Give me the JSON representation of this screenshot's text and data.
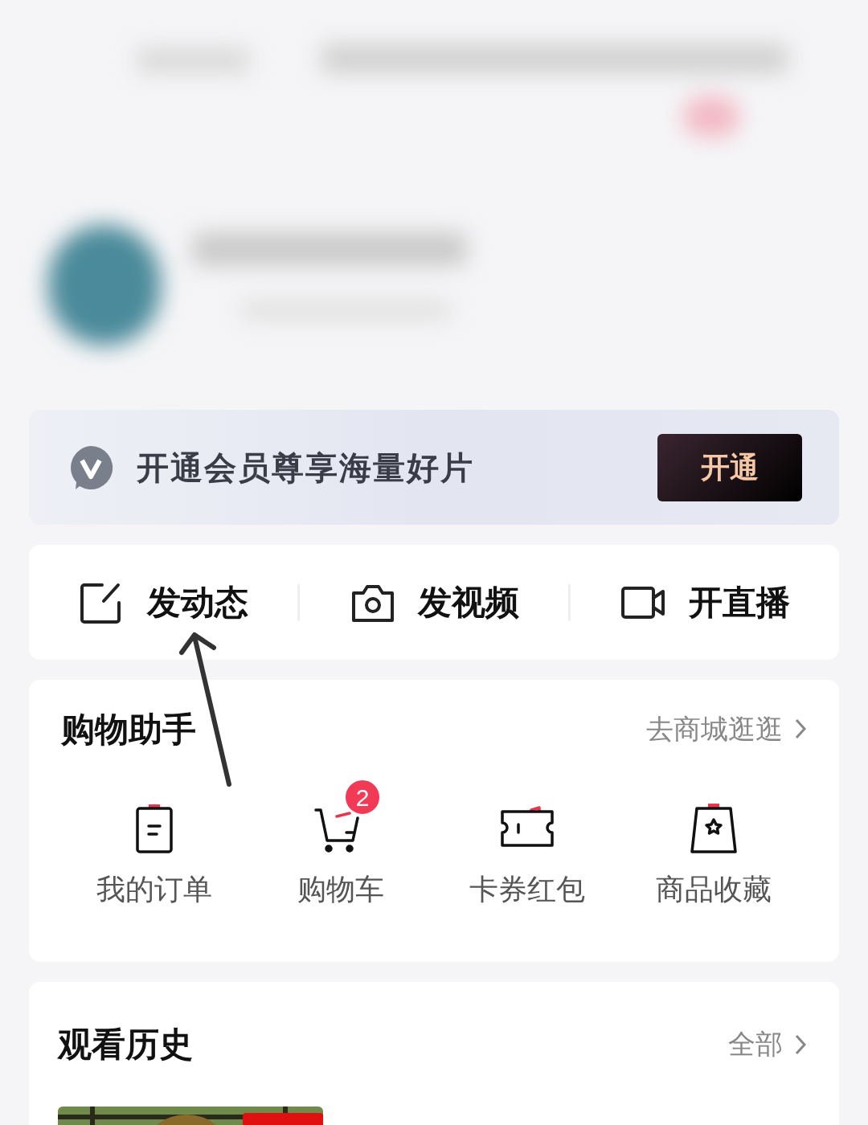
{
  "member_banner": {
    "text": "开通会员尊享海量好片",
    "button": "开通"
  },
  "quick_actions": [
    {
      "label": "发动态",
      "kind": "post"
    },
    {
      "label": "发视频",
      "kind": "camera"
    },
    {
      "label": "开直播",
      "kind": "live"
    }
  ],
  "shopping": {
    "title": "购物助手",
    "link": "去商城逛逛",
    "items": [
      {
        "label": "我的订单",
        "kind": "order"
      },
      {
        "label": "购物车",
        "kind": "cart",
        "badge": "2"
      },
      {
        "label": "卡券红包",
        "kind": "coupon"
      },
      {
        "label": "商品收藏",
        "kind": "favorite"
      }
    ]
  },
  "history": {
    "title": "观看历史",
    "link": "全部"
  }
}
